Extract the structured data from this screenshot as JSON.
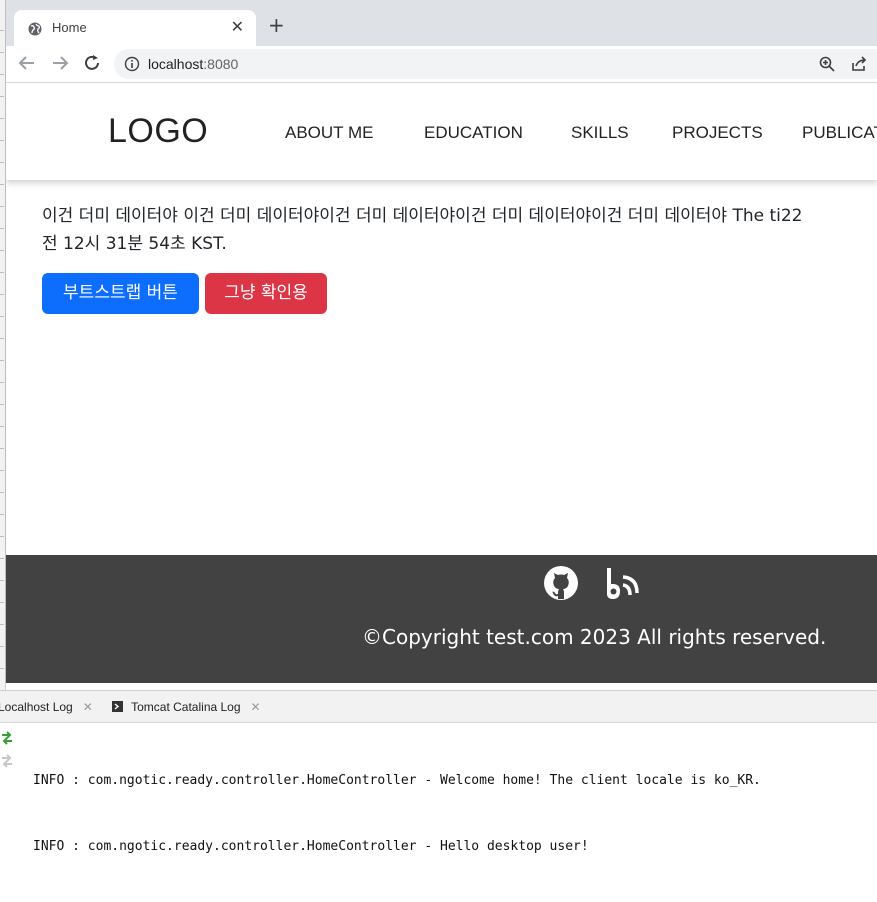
{
  "browser": {
    "tab_title": "Home",
    "url_host": "localhost",
    "url_port": ":8080"
  },
  "site": {
    "logo": "LOGO",
    "nav": [
      "ABOUT ME",
      "EDUCATION",
      "SKILLS",
      "PROJECTS",
      "PUBLICAT"
    ],
    "content_line1": "이건 더미 데이터야 이건 더미 데이터야이건 더미 데이터야이건 더미 데이터야이건 더미 데이터야 The ti22",
    "content_line2": "전 12시 31분 54초 KST.",
    "btn_primary": "부트스트랩 버튼",
    "btn_danger": "그냥 확인용",
    "copyright": "©Copyright test.com 2023 All rights reserved."
  },
  "ide": {
    "tabs": [
      "Localhost Log",
      "Tomcat Catalina Log"
    ],
    "log_lines": [
      "INFO : com.ngotic.ready.controller.HomeController - Welcome home! The client locale is ko_KR.",
      "INFO : com.ngotic.ready.controller.HomeController - Hello desktop user!"
    ]
  },
  "colors": {
    "primary": "#0d6efd",
    "danger": "#dc3545",
    "footer_bg": "#424242"
  }
}
